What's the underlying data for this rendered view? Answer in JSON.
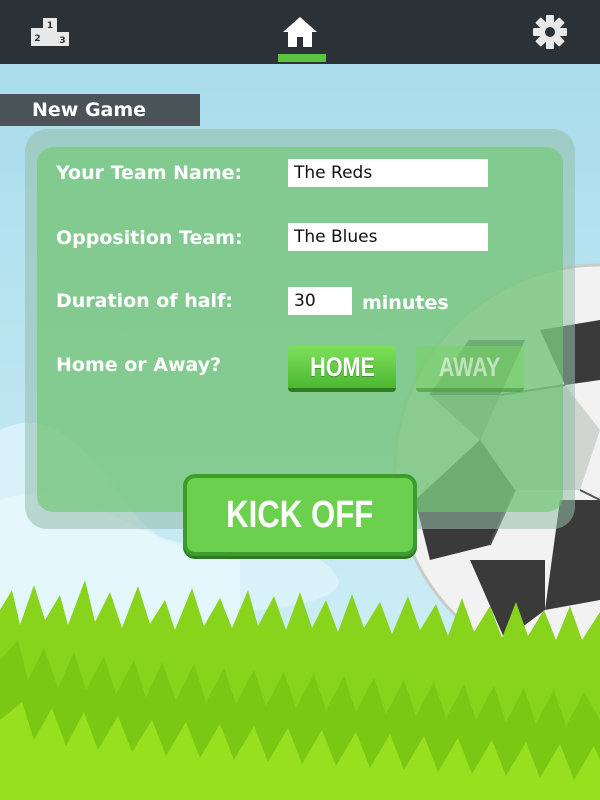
{
  "nav": {
    "rank_icon": "podium-icon",
    "home_icon": "home-icon",
    "settings_icon": "gear-icon",
    "podium_digits": [
      "1",
      "2",
      "3"
    ]
  },
  "colors": {
    "nav_bg": "#2b3237",
    "accent": "#5cc43d",
    "sky": "#aee0ee",
    "grass": "#7fd11b"
  },
  "title": "New Game",
  "form": {
    "team_label": "Your Team Name:",
    "team_value": "The Reds",
    "opposition_label": "Opposition Team:",
    "opposition_value": "The Blues",
    "duration_label": "Duration of half:",
    "duration_value": "30",
    "duration_unit": "minutes",
    "venue_label": "Home or Away?",
    "home_label": "HOME",
    "away_label": "AWAY",
    "venue_selected": "HOME"
  },
  "kickoff_label": "KICK OFF"
}
